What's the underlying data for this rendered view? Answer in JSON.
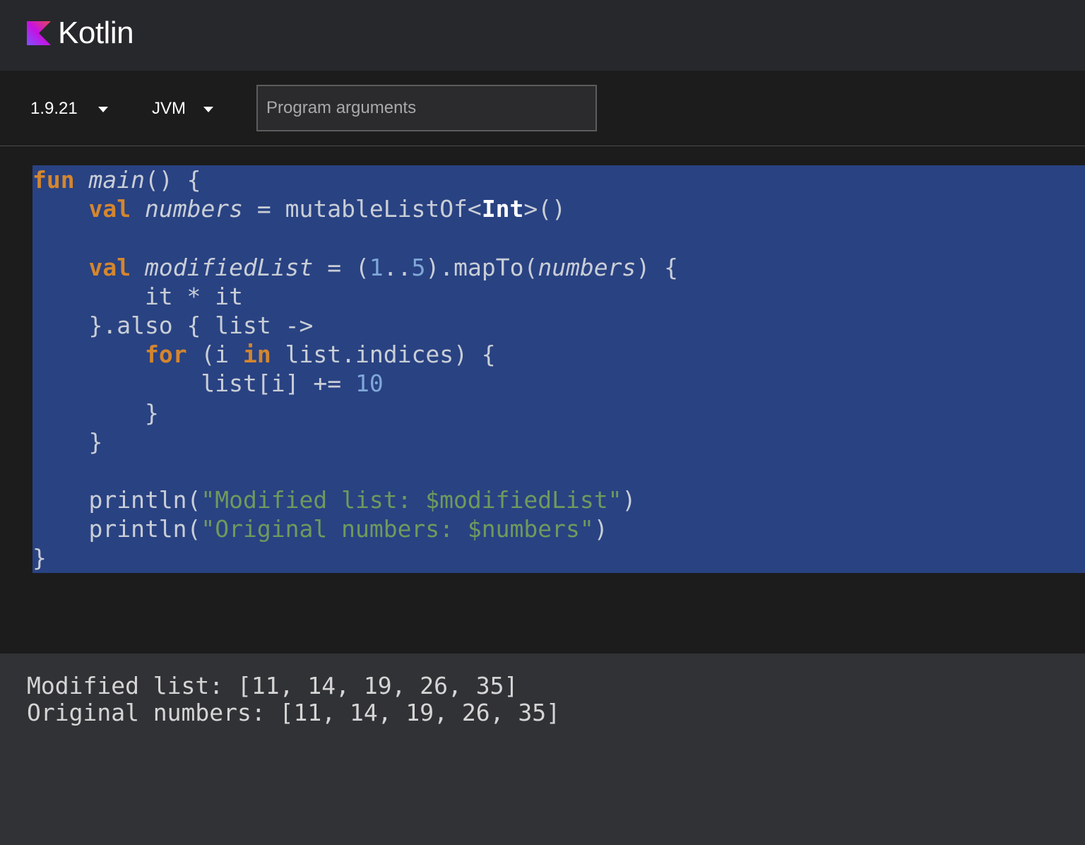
{
  "header": {
    "logo_text": "Kotlin",
    "logo_icon": "kotlin-logo-icon"
  },
  "toolbar": {
    "version": "1.9.21",
    "target": "JVM",
    "args_placeholder": "Program arguments",
    "args_value": ""
  },
  "editor": {
    "language": "kotlin",
    "selection_color": "#294282",
    "lines": [
      "fun main() {",
      "    val numbers = mutableListOf<Int>()",
      "",
      "    val modifiedList = (1..5).mapTo(numbers) {",
      "        it * it",
      "    }.also { list ->",
      "        for (i in list.indices) {",
      "            list[i] += 10",
      "        }",
      "    }",
      "",
      "    println(\"Modified list: $modifiedList\")",
      "    println(\"Original numbers: $numbers\")",
      "}"
    ]
  },
  "output": {
    "lines": [
      "Modified list: [11, 14, 19, 26, 35]",
      "Original numbers: [11, 14, 19, 26, 35]"
    ]
  },
  "colors": {
    "keyword": "#d4862e",
    "number": "#7fa8d9",
    "string": "#6f9a5d",
    "header_bg": "#27282c",
    "output_bg": "#313235"
  }
}
